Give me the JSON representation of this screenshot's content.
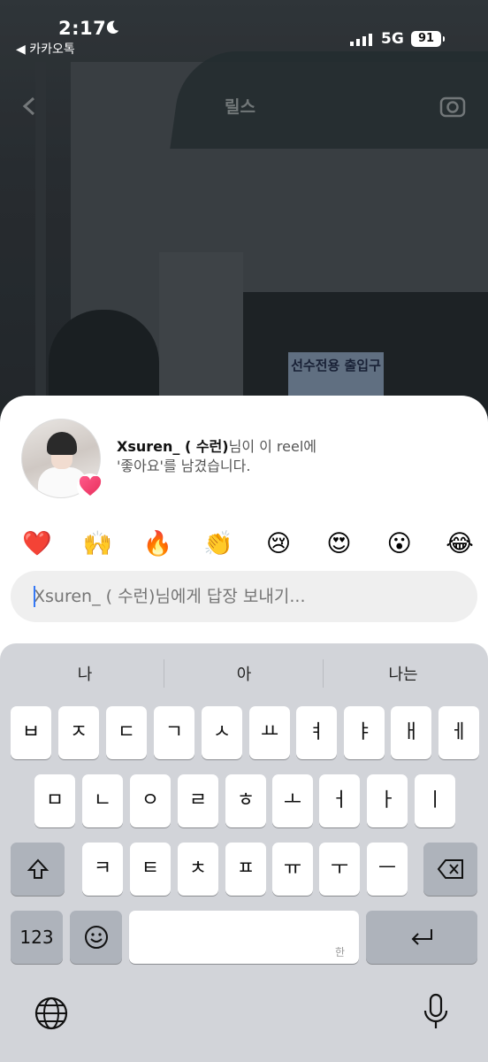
{
  "status": {
    "time": "2:17",
    "back_app": "◀ 카카오톡",
    "network": "5G",
    "battery": "91"
  },
  "reel": {
    "title": "릴스",
    "sign_text": "선수전용 출입구"
  },
  "notification": {
    "username": "Xsuren_ ( 수런)",
    "line1_suffix": "님이 이 reel에",
    "line2": "'좋아요'를 남겼습니다."
  },
  "reactions": [
    "❤️",
    "🙌",
    "🔥",
    "👏",
    "😢",
    "😍",
    "😮",
    "😂"
  ],
  "reply": {
    "placeholder": "Xsuren_ ( 수런)님에게 답장 보내기..."
  },
  "keyboard": {
    "suggestions": [
      "나",
      "아",
      "나는"
    ],
    "row1": [
      "ㅂ",
      "ㅈ",
      "ㄷ",
      "ㄱ",
      "ㅅ",
      "ㅛ",
      "ㅕ",
      "ㅑ",
      "ㅐ",
      "ㅔ"
    ],
    "row2": [
      "ㅁ",
      "ㄴ",
      "ㅇ",
      "ㄹ",
      "ㅎ",
      "ㅗ",
      "ㅓ",
      "ㅏ",
      "ㅣ"
    ],
    "row3": [
      "ㅋ",
      "ㅌ",
      "ㅊ",
      "ㅍ",
      "ㅠ",
      "ㅜ",
      "ㅡ"
    ],
    "numbers_label": "123",
    "space_hint": "한"
  },
  "icons": {
    "moon": "moon-icon",
    "signal": "signal-icon",
    "back": "chevron-left-icon",
    "camera": "camera-icon",
    "heart_badge": "heart-icon",
    "shift": "shift-icon",
    "delete": "backspace-icon",
    "emoji": "emoji-icon",
    "return": "return-icon",
    "globe": "globe-icon",
    "mic": "microphone-icon"
  }
}
